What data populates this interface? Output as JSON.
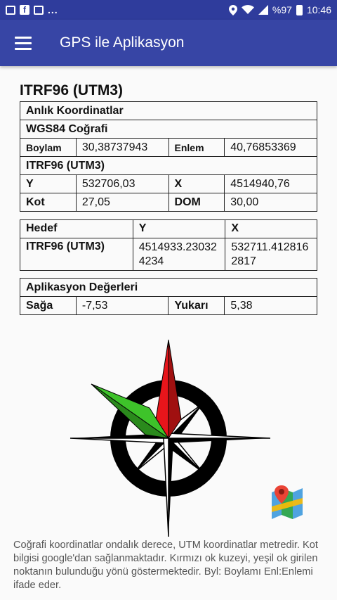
{
  "status_bar": {
    "icons": [
      "image-icon",
      "facebook-icon",
      "outlook-icon"
    ],
    "more": "...",
    "signal_text": "%97",
    "time": "10:46"
  },
  "app_bar": {
    "title": "GPS ile Aplikasyon"
  },
  "heading": "ITRF96 (UTM3)",
  "current_coordinates": {
    "title": "Anlık Koordinatlar",
    "wgs84_title": "WGS84 Coğrafi",
    "boylam_label": "Boylam",
    "boylam_value": "30,38737943",
    "enlem_label": "Enlem",
    "enlem_value": "40,76853369",
    "itrf_title": "ITRF96 (UTM3)",
    "y_label": "Y",
    "y_value": "532706,03",
    "x_label": "X",
    "x_value": "4514940,76",
    "kot_label": "Kot",
    "kot_value": "27,05",
    "dom_label": "DOM",
    "dom_value": "30,00"
  },
  "target": {
    "col_hedef": "Hedef",
    "col_y": "Y",
    "col_x": "X",
    "row_label": "ITRF96 (UTM3)",
    "row_y": "4514933.230324234",
    "row_x": "532711.4128162817"
  },
  "app_values": {
    "title": "Aplikasyon Değerleri",
    "saga_label": "Sağa",
    "saga_value": "-7,53",
    "yukari_label": "Yukarı",
    "yukari_value": "5,38"
  },
  "compass": {
    "north_color": "#e8151b",
    "target_color": "#3ec32a"
  },
  "footer_text": "Coğrafi koordinatlar ondalık derece, UTM koordinatlar metredir. Kot bilgisi google'dan sağlanmaktadır. Kırmızı ok kuzeyi, yeşil ok girilen noktanın bulunduğu yönü göstermektedir. Byl: Boylamı Enl:Enlemi ifade eder."
}
